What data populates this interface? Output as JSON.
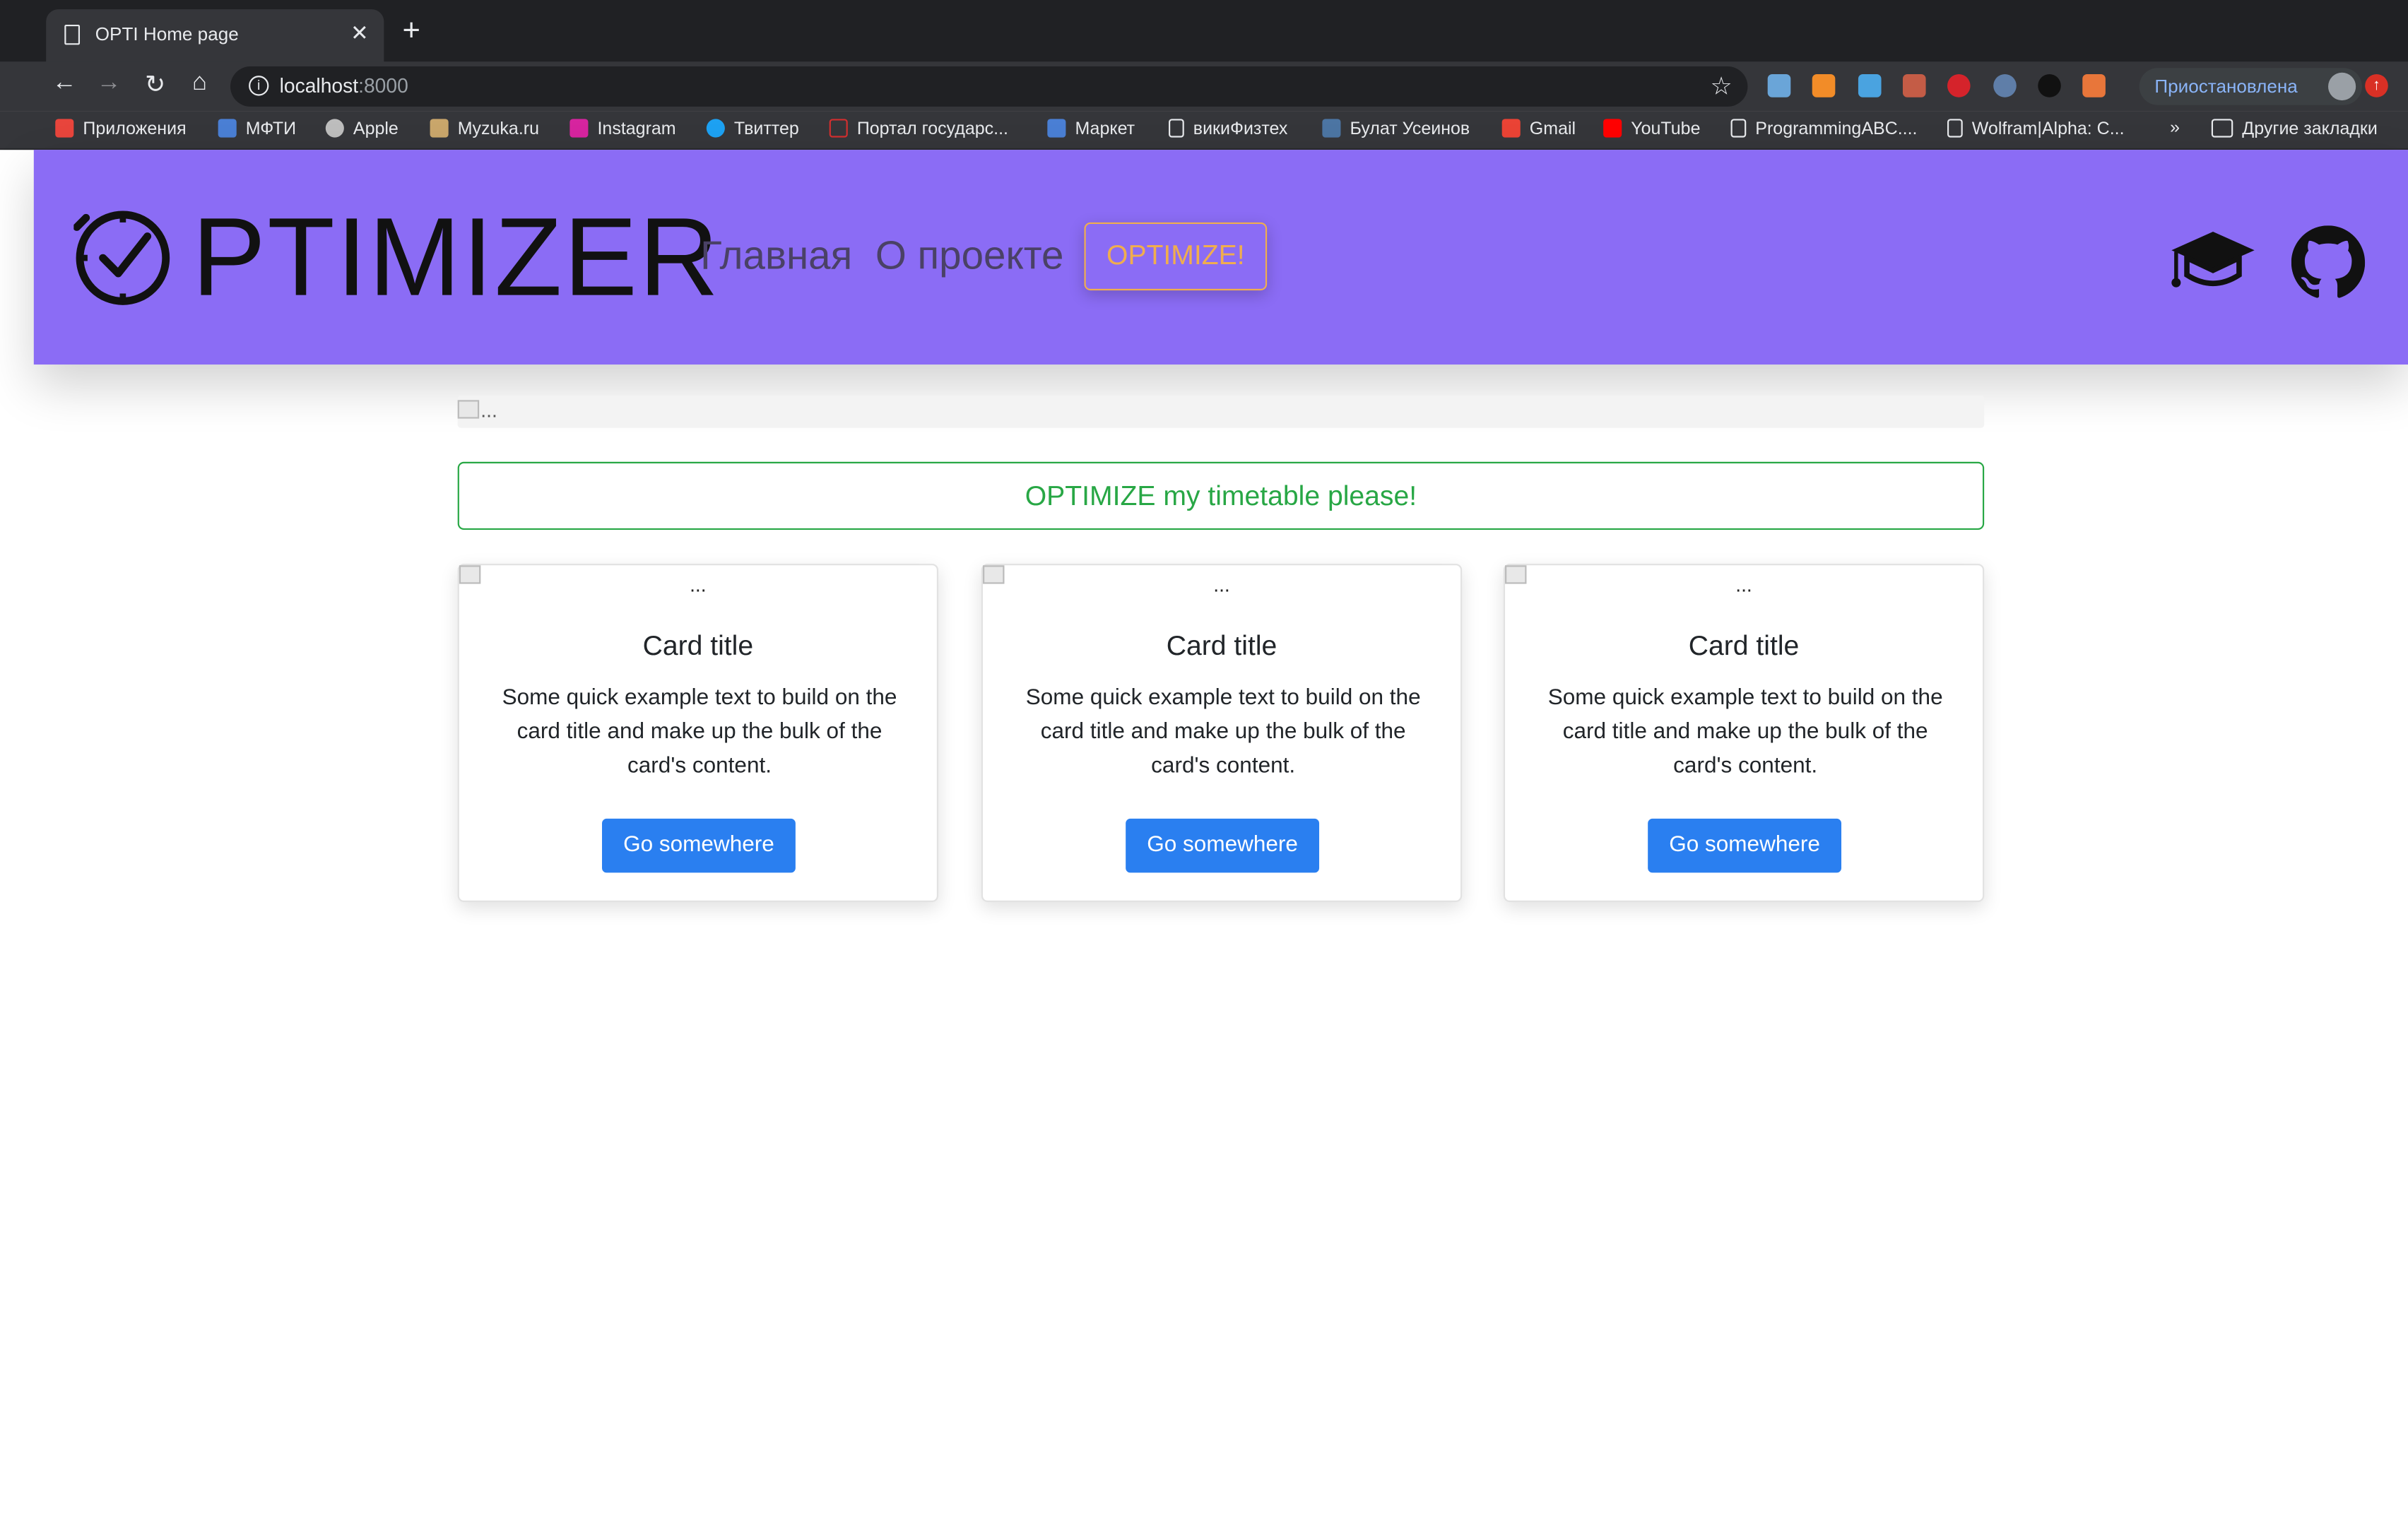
{
  "browser": {
    "tab_title": "OPTI Home page",
    "tab_close": "✕",
    "new_tab": "+",
    "url_host": "localhost",
    "url_port": ":8000",
    "profile_label": "Приостановлена",
    "bookmarks": [
      {
        "label": "Приложения",
        "icon": "apps-grid-icon",
        "color": "#e8453c"
      },
      {
        "label": "МФТИ",
        "icon": "mipt-icon",
        "color": "#4a7fd4"
      },
      {
        "label": "Apple",
        "icon": "apple-icon",
        "color": "#bdbdbd"
      },
      {
        "label": "Myzuka.ru",
        "icon": "music-icon",
        "color": "#c9a66b"
      },
      {
        "label": "Instagram",
        "icon": "instagram-icon",
        "color": "#d6249f"
      },
      {
        "label": "Твиттер",
        "icon": "twitter-icon",
        "color": "#1da1f2"
      },
      {
        "label": "Портал государс...",
        "icon": "gov-portal-icon",
        "color": "#d32f2f"
      },
      {
        "label": "Маркет",
        "icon": "market-icon",
        "color": "#4a7fd4"
      },
      {
        "label": "викиФизтех",
        "icon": "document-icon",
        "color": "#e8eaed"
      },
      {
        "label": "Булат Усеинов",
        "icon": "vk-icon",
        "color": "#4c75a3"
      },
      {
        "label": "Gmail",
        "icon": "gmail-icon",
        "color": "#ea4335"
      },
      {
        "label": "YouTube",
        "icon": "youtube-icon",
        "color": "#ff0000"
      },
      {
        "label": "ProgrammingABC....",
        "icon": "document-icon",
        "color": "#e8eaed"
      },
      {
        "label": "Wolfram|Alpha: C...",
        "icon": "document-icon",
        "color": "#e8eaed"
      }
    ],
    "overflow": "»",
    "other_bookmarks": "Другие закладки"
  },
  "site": {
    "logo_text": "PTIMIZER",
    "nav": [
      "Главная",
      "О проекте"
    ],
    "optimize_label": "OPTIMIZE!",
    "banner_alt": "...",
    "timetable_label": "OPTIMIZE my timetable please!",
    "cards": [
      {
        "alt": "...",
        "title": "Card title",
        "text": "Some quick example text to build on the card title and make up the bulk of the card's content.",
        "button": "Go somewhere"
      },
      {
        "alt": "...",
        "title": "Card title",
        "text": "Some quick example text to build on the card title and make up the bulk of the card's content.",
        "button": "Go somewhere"
      },
      {
        "alt": "...",
        "title": "Card title",
        "text": "Some quick example text to build on the card title and make up the bulk of the card's content.",
        "button": "Go somewhere"
      }
    ]
  },
  "colors": {
    "navbar": "#8b6cf5",
    "optimize_button": "#f0ad4e",
    "timetable_button": "#28a745",
    "card_button": "#2a7ff0"
  }
}
